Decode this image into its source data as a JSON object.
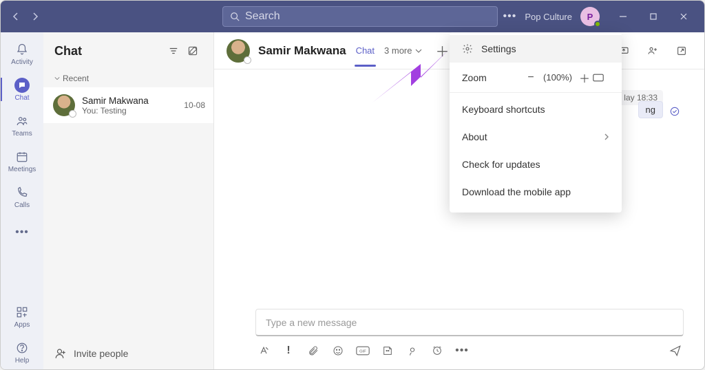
{
  "titlebar": {
    "search_placeholder": "Search",
    "org_name": "Pop Culture",
    "avatar_initial": "P"
  },
  "rail": {
    "activity": "Activity",
    "chat": "Chat",
    "teams": "Teams",
    "meetings": "Meetings",
    "calls": "Calls",
    "apps": "Apps",
    "help": "Help"
  },
  "chatlist": {
    "title": "Chat",
    "section": "Recent",
    "items": [
      {
        "name": "Samir Makwana",
        "preview": "You: Testing",
        "time": "10-08"
      }
    ],
    "invite": "Invite people"
  },
  "chathead": {
    "name": "Samir Makwana",
    "tab_chat": "Chat",
    "more_tabs": "3 more"
  },
  "messages": {
    "time": "lay 18:33",
    "body": "ng"
  },
  "compose": {
    "placeholder": "Type a new message"
  },
  "dropdown": {
    "settings": "Settings",
    "zoom_label": "Zoom",
    "zoom_value": "(100%)",
    "keyboard": "Keyboard shortcuts",
    "about": "About",
    "updates": "Check for updates",
    "download": "Download the mobile app"
  }
}
